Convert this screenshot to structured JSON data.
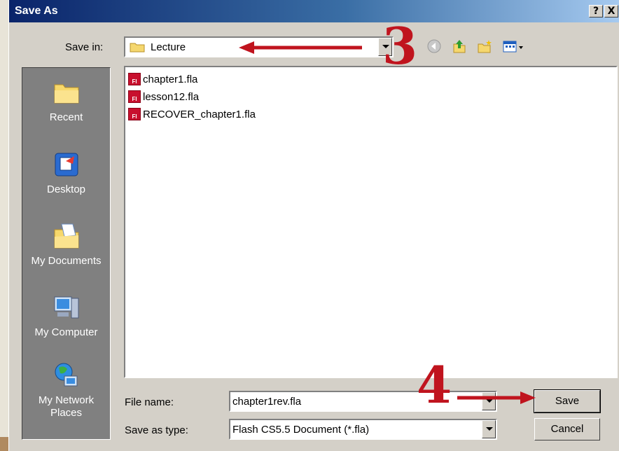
{
  "window": {
    "title": "Save As",
    "help_label": "?",
    "close_label": "X"
  },
  "save_in": {
    "label": "Save in:",
    "value": "Lecture"
  },
  "toolbar": {
    "icons": [
      "back-icon",
      "up-folder-icon",
      "new-folder-icon",
      "view-menu-icon"
    ]
  },
  "places": [
    {
      "label": "Recent",
      "icon": "recent-folder-icon"
    },
    {
      "label": "Desktop",
      "icon": "desktop-icon"
    },
    {
      "label": "My Documents",
      "icon": "my-documents-icon"
    },
    {
      "label": "My Computer",
      "icon": "my-computer-icon"
    },
    {
      "label": "My Network Places",
      "icon": "network-places-icon"
    }
  ],
  "files": [
    {
      "name": "chapter1.fla",
      "icon": "flash-file-icon",
      "icon_text": "Fl"
    },
    {
      "name": "lesson12.fla",
      "icon": "flash-file-icon",
      "icon_text": "Fl"
    },
    {
      "name": "RECOVER_chapter1.fla",
      "icon": "flash-file-icon",
      "icon_text": "Fl"
    }
  ],
  "file_name": {
    "label": "File name:",
    "value": "chapter1rev.fla"
  },
  "save_as_type": {
    "label": "Save as type:",
    "value": "Flash CS5.5 Document (*.fla)"
  },
  "buttons": {
    "save": "Save",
    "cancel": "Cancel"
  },
  "annotations": {
    "step3": "3",
    "step4": "4",
    "color": "#c0141e"
  },
  "colors": {
    "titlebar_start": "#0a246a",
    "dialog_bg": "#d4d0c8",
    "places_bg": "#808080"
  }
}
